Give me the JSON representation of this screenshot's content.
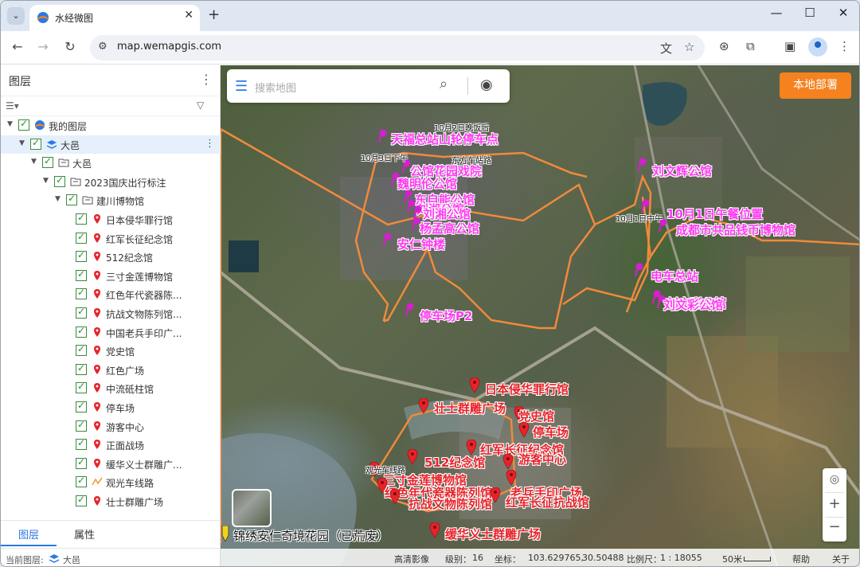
{
  "browser": {
    "tab_title": "水经微图",
    "url": "map.wemapgis.com",
    "colors": {
      "tabstrip": "#dfe7f3",
      "omnibox": "#eef2f7"
    }
  },
  "sidebar": {
    "title": "图层",
    "tree": [
      {
        "label": "我的图层",
        "level": 0,
        "icon": "logo-icon"
      },
      {
        "label": "大邑",
        "level": 1,
        "icon": "layer-stack-icon",
        "selected": true
      },
      {
        "label": "大邑",
        "level": 2,
        "icon": "folder-icon"
      },
      {
        "label": "2023国庆出行标注",
        "level": 3,
        "icon": "folder-icon"
      },
      {
        "label": "建川博物馆",
        "level": 4,
        "icon": "folder-icon"
      },
      {
        "label": "日本侵华罪行馆",
        "level": 5,
        "icon": "pin-icon"
      },
      {
        "label": "红军长征纪念馆",
        "level": 5,
        "icon": "pin-icon"
      },
      {
        "label": "512纪念馆",
        "level": 5,
        "icon": "pin-icon"
      },
      {
        "label": "三寸金莲博物馆",
        "level": 5,
        "icon": "pin-icon"
      },
      {
        "label": "红色年代瓷器陈...",
        "level": 5,
        "icon": "pin-icon"
      },
      {
        "label": "抗战文物陈列馆...",
        "level": 5,
        "icon": "pin-icon"
      },
      {
        "label": "中国老兵手印广...",
        "level": 5,
        "icon": "pin-icon"
      },
      {
        "label": "党史馆",
        "level": 5,
        "icon": "pin-icon"
      },
      {
        "label": "红色广场",
        "level": 5,
        "icon": "pin-icon"
      },
      {
        "label": "中流砥柱馆",
        "level": 5,
        "icon": "pin-icon"
      },
      {
        "label": "停车场",
        "level": 5,
        "icon": "pin-icon"
      },
      {
        "label": "游客中心",
        "level": 5,
        "icon": "pin-icon"
      },
      {
        "label": "正面战场",
        "level": 5,
        "icon": "pin-icon"
      },
      {
        "label": "缓华义士群雕广...",
        "level": 5,
        "icon": "pin-icon"
      },
      {
        "label": "观光车线路",
        "level": 5,
        "icon": "line-icon"
      },
      {
        "label": "壮士群雕广场",
        "level": 5,
        "icon": "pin-icon"
      }
    ],
    "tabs": {
      "layers": "图层",
      "properties": "属性"
    },
    "status": {
      "label": "当前图层:",
      "layer": "大邑"
    }
  },
  "map": {
    "search_placeholder": "搜索地图",
    "deploy_button": "本地部署",
    "magenta_labels": [
      "天福总站山轮停车点",
      "公馆花园戏院",
      "魏明伦公馆",
      "东自能公馆",
      "刘湘公馆",
      "刘湘公馆",
      "杨孟高公馆",
      "安仁钟楼",
      "停车场P2",
      "刘文辉公馆",
      "10月1日午餐位置",
      "成都市共品钱币博物馆",
      "电车总站",
      "刘文彩公馆",
      "刘文彩公馆"
    ],
    "red_labels": [
      "日本侵华罪行馆",
      "壮士群雕广场",
      "党史馆",
      "停车场",
      "红军长征纪念馆",
      "512纪念馆",
      "游客中心",
      "三寸金莲博物馆",
      "红色年代瓷器陈列馆",
      "老兵手印广场",
      "抗战文物陈列馆",
      "红军长征抗战馆",
      "缓华义士群雕广场"
    ],
    "small_labels": [
      "10月2日晚饭后",
      "10月3日下午",
      "东方车站路",
      "10月1日中午",
      "观光车线路"
    ],
    "bottom_label": "锦绣安仁奇境花园（已荒废）",
    "status": {
      "imagery": "高清影像",
      "level_label": "级别：",
      "level": "16",
      "coord_label": "坐标：",
      "lon": "103.629765,",
      "lat": "30.50488",
      "scale_label": "比例尺：",
      "scale": "1 : 18055",
      "scale_text": "50米",
      "help": "帮助",
      "about": "关于"
    },
    "colors": {
      "route": "#f08a3c",
      "magenta": "#ff3af2",
      "red": "#e8232a",
      "deploy": "#f5821f"
    }
  }
}
